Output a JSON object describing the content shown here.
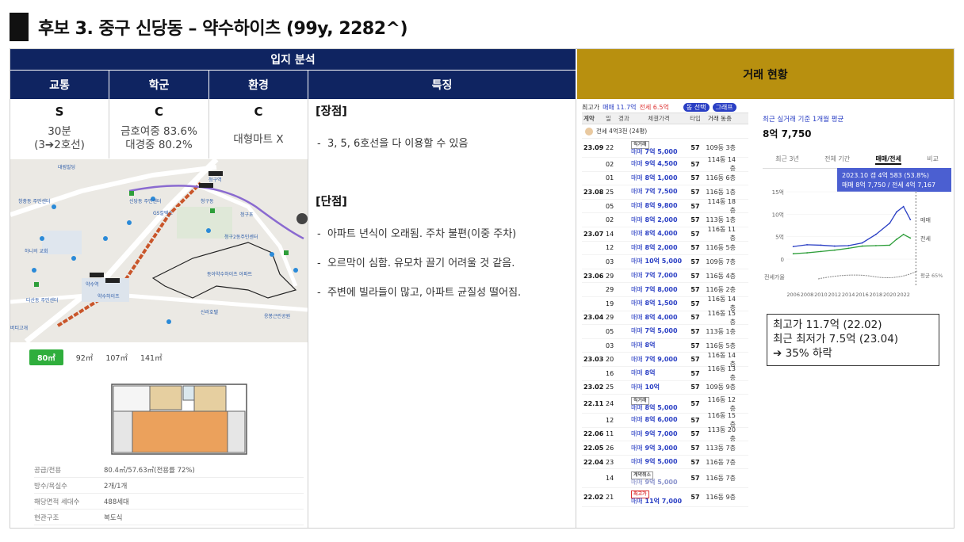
{
  "title": "후보 3. 중구 신당동 – 약수하이츠 (99y, 2282^)",
  "location_analysis": {
    "header": "입지 분석",
    "columns": [
      "교통",
      "학군",
      "환경",
      "특징"
    ],
    "grades": [
      {
        "grade": "S",
        "desc_lines": [
          "30분",
          "(3➔2호선)"
        ]
      },
      {
        "grade": "C",
        "desc_lines": [
          "금호여중 83.6%",
          "대경중 80.2%"
        ]
      },
      {
        "grade": "C",
        "desc_lines": [
          "대형마트 X"
        ]
      }
    ],
    "features": {
      "pros_title": "[장점]",
      "pros": [
        "3, 5, 6호선을 다 이용할 수 있음"
      ],
      "cons_title": "[단점]",
      "cons": [
        "아파트 년식이 오래됨. 주차 불편(이중 주차)",
        "오르막이 심함. 유모차 끌기 어려울 것 같음.",
        "주변에 빌라들이 많고, 아파트 균질성 떨어짐."
      ]
    }
  },
  "map": {
    "labels": [
      "대림빌딩",
      "창충동 주민센터",
      "하니의 교회",
      "청구동",
      "청구초",
      "GS칼텍스",
      "약수하이츠",
      "다산동 주민센터",
      "신당동 주민센터",
      "청구역",
      "약수역",
      "버티고개",
      "동아약수하이츠 아파트",
      "청구2동주민센터",
      "신라호텔",
      "응봉근린공원"
    ]
  },
  "floorplan": {
    "tabs": [
      "80㎡",
      "92㎡",
      "107㎡",
      "141㎡"
    ],
    "selected_tab": "80㎡",
    "rows": [
      {
        "key": "공급/전용",
        "value": "80.4㎡/57.63㎡(전용률 72%)"
      },
      {
        "key": "방수/욕실수",
        "value": "2개/1개"
      },
      {
        "key": "해당면적 세대수",
        "value": "488세대"
      },
      {
        "key": "현관구조",
        "value": "복도식"
      }
    ]
  },
  "transactions": {
    "header": "거래 현황",
    "top_bar": {
      "label1": "최고가",
      "sale": "매매 11.7억",
      "jeonse": "전세 6.5억",
      "btn1": "동 선택",
      "btn2": "그래프"
    },
    "columns": [
      "계약",
      "일",
      "경과",
      "체결가격",
      "타입",
      "거래 동층"
    ],
    "sub_row": "전세 4억3천 (24평)",
    "rows": [
      {
        "month": "23.09",
        "day": "22",
        "tag": "직거래",
        "price": "7억 5,000",
        "type": "57",
        "floor": "109동 3층"
      },
      {
        "month": "",
        "day": "02",
        "tag": "",
        "price": "9억 4,500",
        "type": "57",
        "floor": "114동 14층"
      },
      {
        "month": "",
        "day": "01",
        "tag": "",
        "price": "8억 1,000",
        "type": "57",
        "floor": "116동 6층"
      },
      {
        "month": "23.08",
        "day": "25",
        "tag": "",
        "price": "7억 7,500",
        "type": "57",
        "floor": "116동 1층"
      },
      {
        "month": "",
        "day": "05",
        "tag": "",
        "price": "8억 9,800",
        "type": "57",
        "floor": "114동 18층"
      },
      {
        "month": "",
        "day": "02",
        "tag": "",
        "price": "8억 2,000",
        "type": "57",
        "floor": "113동 1층"
      },
      {
        "month": "23.07",
        "day": "14",
        "tag": "",
        "price": "8억 4,000",
        "type": "57",
        "floor": "116동 11층"
      },
      {
        "month": "",
        "day": "12",
        "tag": "",
        "price": "8억 2,000",
        "type": "57",
        "floor": "116동 5층",
        "pink": true
      },
      {
        "month": "",
        "day": "03",
        "tag": "",
        "price": "10억 5,000",
        "type": "57",
        "floor": "109동 7층"
      },
      {
        "month": "23.06",
        "day": "29",
        "tag": "",
        "price": "7억 7,000",
        "type": "57",
        "floor": "116동 4층"
      },
      {
        "month": "",
        "day": "29",
        "tag": "",
        "price": "7억 8,000",
        "type": "57",
        "floor": "116동 2층"
      },
      {
        "month": "",
        "day": "19",
        "tag": "",
        "price": "8억 1,500",
        "type": "57",
        "floor": "116동 14층"
      },
      {
        "month": "23.04",
        "day": "29",
        "tag": "",
        "price": "8억 4,000",
        "type": "57",
        "floor": "116동 15층",
        "pink": true
      },
      {
        "month": "",
        "day": "05",
        "tag": "",
        "price": "7억 5,000",
        "type": "57",
        "floor": "113동 1층"
      },
      {
        "month": "",
        "day": "03",
        "tag": "",
        "price": "8억",
        "type": "57",
        "floor": "116동 5층"
      },
      {
        "month": "23.03",
        "day": "20",
        "tag": "",
        "price": "7억 9,000",
        "type": "57",
        "floor": "116동 14층"
      },
      {
        "month": "",
        "day": "16",
        "tag": "",
        "price": "8억",
        "type": "57",
        "floor": "116동 13층"
      },
      {
        "month": "23.02",
        "day": "25",
        "tag": "",
        "price": "10억",
        "type": "57",
        "floor": "109동 9층",
        "pink": true
      },
      {
        "month": "22.11",
        "day": "24",
        "tag": "직거래",
        "price": "8억 5,000",
        "type": "57",
        "floor": "116동 12층"
      },
      {
        "month": "",
        "day": "12",
        "tag": "",
        "price": "8억 6,000",
        "type": "57",
        "floor": "116동 15층"
      },
      {
        "month": "22.06",
        "day": "11",
        "tag": "",
        "price": "9억 7,000",
        "type": "57",
        "floor": "113동 20층"
      },
      {
        "month": "22.05",
        "day": "26",
        "tag": "",
        "price": "9억 3,000",
        "type": "57",
        "floor": "113동 7층"
      },
      {
        "month": "22.04",
        "day": "23",
        "tag": "",
        "price": "9억 5,000",
        "type": "57",
        "floor": "116동 7층"
      },
      {
        "month": "",
        "day": "14",
        "tag": "계약취소",
        "price": "9억 5,000",
        "type": "57",
        "floor": "116동 7층",
        "faded": true
      },
      {
        "month": "22.02",
        "day": "21",
        "tag": "최고가",
        "tag_red": true,
        "price": "11억 7,000",
        "type": "57",
        "floor": "116동 9층"
      }
    ],
    "sale_prefix": "매매"
  },
  "chart": {
    "subtitle": "최근 실거래 기준 1개월 평균",
    "price": "8억 7,750",
    "tabs": [
      "최근 3년",
      "전체 기간",
      "매매/전세",
      "비교"
    ],
    "selected_tab": "매매/전세",
    "tooltip_line1": "2023.10  갭 4억 583 (53.8%)",
    "tooltip_line2": "매매 8억 7,750 / 전세 4억 7,167",
    "y_ticks": [
      "15억",
      "10억",
      "5억",
      "0"
    ],
    "ratio_label": "전세가율",
    "x_ticks": [
      "2006",
      "2008",
      "2010",
      "2012",
      "2014",
      "2016",
      "2018",
      "2020",
      "2022"
    ],
    "series_labels": [
      "매매",
      "전세",
      "평균 65%"
    ],
    "colors": {
      "sale": "#2a3fc4",
      "jeonse": "#2e9e3a",
      "ratio": "#888888"
    }
  },
  "chart_data": {
    "type": "line",
    "x": [
      2006,
      2008,
      2010,
      2012,
      2014,
      2016,
      2018,
      2020,
      2021,
      2022,
      2023
    ],
    "series": [
      {
        "name": "매매",
        "values": [
          2.8,
          3.2,
          3.1,
          2.9,
          3.0,
          3.6,
          5.5,
          8.0,
          10.5,
          11.7,
          8.8
        ]
      },
      {
        "name": "전세",
        "values": [
          1.2,
          1.4,
          1.7,
          2.0,
          2.4,
          2.9,
          3.0,
          3.1,
          4.4,
          5.5,
          4.7
        ]
      }
    ],
    "ylim": [
      0,
      15
    ]
  },
  "summary": [
    "최고가 11.7억 (22.02)",
    "최근 최저가 7.5억 (23.04)",
    "➔  35% 하락"
  ]
}
